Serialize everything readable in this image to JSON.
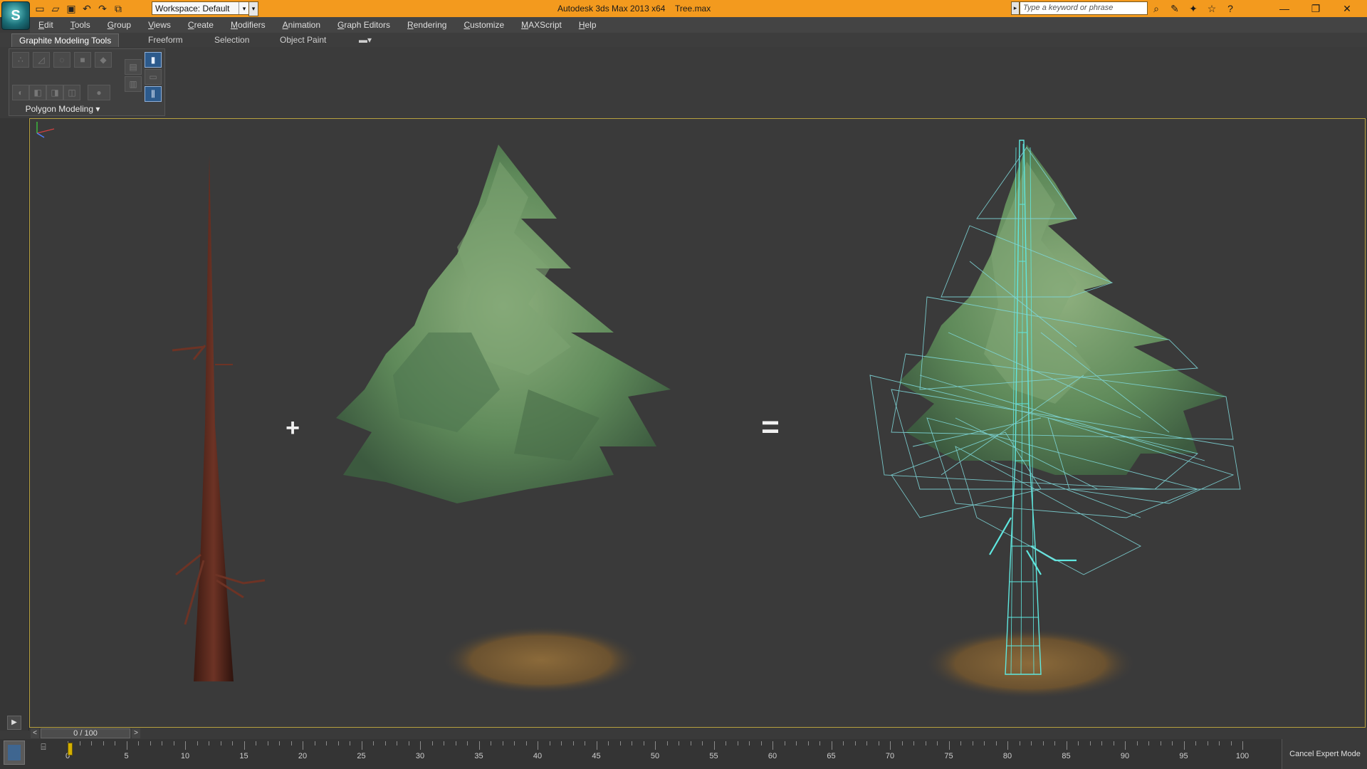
{
  "app": {
    "title": "Autodesk 3ds Max  2013 x64",
    "file": "Tree.max",
    "logo": "S"
  },
  "quick_access": {
    "workspace_label": "Workspace: Default",
    "search_placeholder": "Type a keyword or phrase"
  },
  "menu": [
    {
      "label": "Edit"
    },
    {
      "label": "Tools"
    },
    {
      "label": "Group"
    },
    {
      "label": "Views"
    },
    {
      "label": "Create"
    },
    {
      "label": "Modifiers"
    },
    {
      "label": "Animation"
    },
    {
      "label": "Graph Editors"
    },
    {
      "label": "Rendering"
    },
    {
      "label": "Customize"
    },
    {
      "label": "MAXScript"
    },
    {
      "label": "Help"
    }
  ],
  "ribbon": {
    "tabs": [
      {
        "label": "Graphite Modeling Tools"
      },
      {
        "label": "Freeform"
      },
      {
        "label": "Selection"
      },
      {
        "label": "Object Paint"
      }
    ],
    "group_label": "Polygon Modeling ▾"
  },
  "viewport": {
    "plus_symbol": "+",
    "equals_symbol": "=",
    "colors": {
      "border": "#b7a13f",
      "wireframe": "#5fe8e0",
      "foliage": "#5f8a5a",
      "bark": "#5a2a1e"
    }
  },
  "timeline": {
    "frame_display": "0 / 100",
    "ticks": [
      "0",
      "5",
      "10",
      "15",
      "20",
      "25",
      "30",
      "35",
      "40",
      "45",
      "50",
      "55",
      "60",
      "65",
      "70",
      "75",
      "80",
      "85",
      "90",
      "95",
      "100"
    ]
  },
  "status": {
    "expert_mode": "Cancel Expert Mode"
  }
}
